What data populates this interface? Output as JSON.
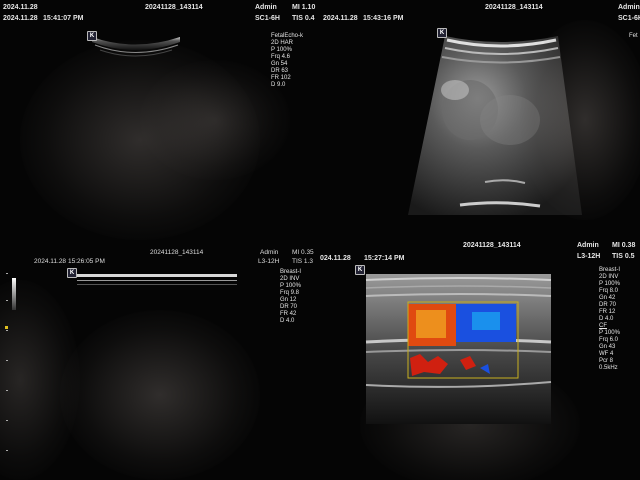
{
  "panels": [
    {
      "id": "fetal-echo",
      "header": {
        "id": "20241128_143114",
        "date": "2024.11.28",
        "time": "15:41:07  PM",
        "operator": "Admin",
        "mi": "MI 1.10",
        "probe": "SC1-6H",
        "tis": "TIS 0.4"
      },
      "preset": "FetalEcho-k",
      "params": [
        "2D HAR",
        "P 100%",
        "Frq 4.6",
        "Gn 54",
        "DR 63",
        "FR 102",
        "D 9.0"
      ],
      "orientation_mark": "K"
    },
    {
      "id": "abdominal",
      "header": {
        "id": "20241128_143114",
        "date": "2024.11.28",
        "time": "15:43:16  PM",
        "operator": "Admin",
        "probe": "SC1-6H"
      },
      "preset": "Fet",
      "orientation_mark": "K"
    },
    {
      "id": "breast-linear",
      "header": {
        "id": "20241128_143114",
        "date": "2024.11.28",
        "time": "15:26:05  PM",
        "operator": "Admin",
        "mi": "MI 0.35",
        "probe": "L3-12H",
        "tis": "TIS 1.3"
      },
      "preset": "Breast-I",
      "params": [
        "2D INV",
        "P 100%",
        "Frq 9.8",
        "Gn 12",
        "DR 70",
        "FR 42",
        "D 4.0"
      ],
      "orientation_mark": "K"
    },
    {
      "id": "breast-color",
      "header": {
        "id": "20241128_143114",
        "date": "024.11.28",
        "time": "15:27:14  PM",
        "operator": "Admin",
        "mi": "MI 0.38",
        "probe": "L3-12H",
        "tis": "TIS 0.5"
      },
      "preset": "Breast-I",
      "params": [
        "2D INV",
        "P 100%",
        "Frq 8.0",
        "Gn 42",
        "DR 70",
        "FR 12",
        "D 4.0"
      ],
      "cf_label": "CF",
      "cf_params": [
        "P 100%",
        "Frq 6.0",
        "Gn 43",
        "WF 4",
        "Pcr 8",
        "0.5kHz"
      ],
      "orientation_mark": "K"
    }
  ],
  "colors": {
    "background": "#000000",
    "text": "#e6e6e6",
    "doppler_red": "#e03010",
    "doppler_blue": "#1a50e0",
    "roi_box": "#c8b020"
  }
}
